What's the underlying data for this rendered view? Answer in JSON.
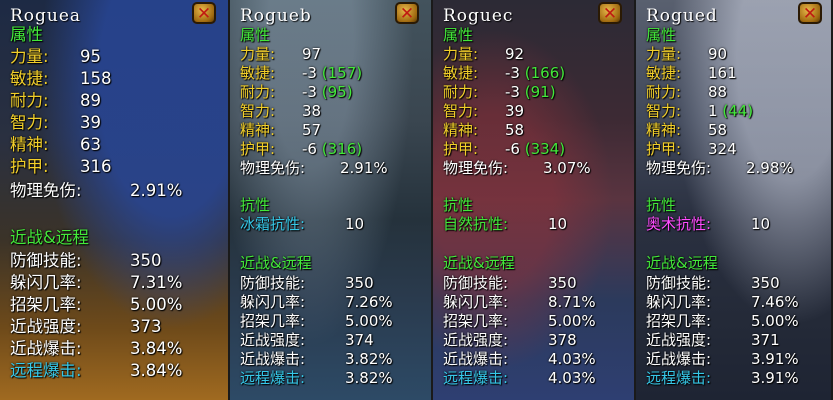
{
  "panels": [
    {
      "name": "Roguea",
      "close_glyph": "✕",
      "sections": {
        "attributes_header": "属性",
        "strength": {
          "label": "力量:",
          "value": "95"
        },
        "agility": {
          "label": "敏捷:",
          "value": "158"
        },
        "stamina": {
          "label": "耐力:",
          "value": "89"
        },
        "intellect": {
          "label": "智力:",
          "value": "39"
        },
        "spirit": {
          "label": "精神:",
          "value": "63"
        },
        "armor": {
          "label": "护甲:",
          "value": "316"
        },
        "phys_reduction": {
          "label": "物理免伤:",
          "value": "2.91%"
        },
        "melee_header": "近战&远程",
        "defense": {
          "label": "防御技能:",
          "value": "350"
        },
        "dodge": {
          "label": "躲闪几率:",
          "value": "7.31%"
        },
        "parry": {
          "label": "招架几率:",
          "value": "5.00%"
        },
        "melee_power": {
          "label": "近战强度:",
          "value": "373"
        },
        "melee_crit": {
          "label": "近战爆击:",
          "value": "3.84%"
        },
        "ranged_crit": {
          "label": "远程爆击:",
          "value": "3.84%"
        }
      }
    },
    {
      "name": "Rogueb",
      "close_glyph": "✕",
      "sections": {
        "attributes_header": "属性",
        "strength": {
          "label": "力量:",
          "value": "97"
        },
        "agility": {
          "label": "敏捷:",
          "value": "-3",
          "mod": "(157)"
        },
        "stamina": {
          "label": "耐力:",
          "value": "-3",
          "mod": "(95)"
        },
        "intellect": {
          "label": "智力:",
          "value": "38"
        },
        "spirit": {
          "label": "精神:",
          "value": "57"
        },
        "armor": {
          "label": "护甲:",
          "value": "-6",
          "mod": "(316)"
        },
        "phys_reduction": {
          "label": "物理免伤:",
          "value": "2.91%"
        },
        "resist_header": "抗性",
        "resist": {
          "label": "冰霜抗性:",
          "value": "10"
        },
        "melee_header": "近战&远程",
        "defense": {
          "label": "防御技能:",
          "value": "350"
        },
        "dodge": {
          "label": "躲闪几率:",
          "value": "7.26%"
        },
        "parry": {
          "label": "招架几率:",
          "value": "5.00%"
        },
        "melee_power": {
          "label": "近战强度:",
          "value": "374"
        },
        "melee_crit": {
          "label": "近战爆击:",
          "value": "3.82%"
        },
        "ranged_crit": {
          "label": "远程爆击:",
          "value": "3.82%"
        }
      }
    },
    {
      "name": "Roguec",
      "close_glyph": "✕",
      "sections": {
        "attributes_header": "属性",
        "strength": {
          "label": "力量:",
          "value": "92"
        },
        "agility": {
          "label": "敏捷:",
          "value": "-3",
          "mod": "(166)"
        },
        "stamina": {
          "label": "耐力:",
          "value": "-3",
          "mod": "(91)"
        },
        "intellect": {
          "label": "智力:",
          "value": "39"
        },
        "spirit": {
          "label": "精神:",
          "value": "58"
        },
        "armor": {
          "label": "护甲:",
          "value": "-6",
          "mod": "(334)"
        },
        "phys_reduction": {
          "label": "物理免伤:",
          "value": "3.07%"
        },
        "resist_header": "抗性",
        "resist": {
          "label": "自然抗性:",
          "value": "10"
        },
        "melee_header": "近战&远程",
        "defense": {
          "label": "防御技能:",
          "value": "350"
        },
        "dodge": {
          "label": "躲闪几率:",
          "value": "8.71%"
        },
        "parry": {
          "label": "招架几率:",
          "value": "5.00%"
        },
        "melee_power": {
          "label": "近战强度:",
          "value": "378"
        },
        "melee_crit": {
          "label": "近战爆击:",
          "value": "4.03%"
        },
        "ranged_crit": {
          "label": "远程爆击:",
          "value": "4.03%"
        }
      }
    },
    {
      "name": "Rogued",
      "close_glyph": "✕",
      "sections": {
        "attributes_header": "属性",
        "strength": {
          "label": "力量:",
          "value": "90"
        },
        "agility": {
          "label": "敏捷:",
          "value": "161"
        },
        "stamina": {
          "label": "耐力:",
          "value": "88"
        },
        "intellect": {
          "label": "智力:",
          "value": "1",
          "mod": "(44)"
        },
        "spirit": {
          "label": "精神:",
          "value": "58"
        },
        "armor": {
          "label": "护甲:",
          "value": "324"
        },
        "phys_reduction": {
          "label": "物理免伤:",
          "value": "2.98%"
        },
        "resist_header": "抗性",
        "resist": {
          "label": "奥术抗性:",
          "value": "10"
        },
        "melee_header": "近战&远程",
        "defense": {
          "label": "防御技能:",
          "value": "350"
        },
        "dodge": {
          "label": "躲闪几率:",
          "value": "7.46%"
        },
        "parry": {
          "label": "招架几率:",
          "value": "5.00%"
        },
        "melee_power": {
          "label": "近战强度:",
          "value": "371"
        },
        "melee_crit": {
          "label": "近战爆击:",
          "value": "3.91%"
        },
        "ranged_crit": {
          "label": "远程爆击:",
          "value": "3.91%"
        }
      }
    }
  ],
  "colors": {
    "header_green": "#43e83a",
    "label_yellow": "#f2cf2a",
    "value_white": "#ffffff",
    "ranged_cyan": "#36c8e8",
    "frost_cyan": "#36c8e8",
    "nature_green": "#43e83a",
    "arcane_pink": "#ff4dff",
    "close_red": "#c01a12"
  }
}
